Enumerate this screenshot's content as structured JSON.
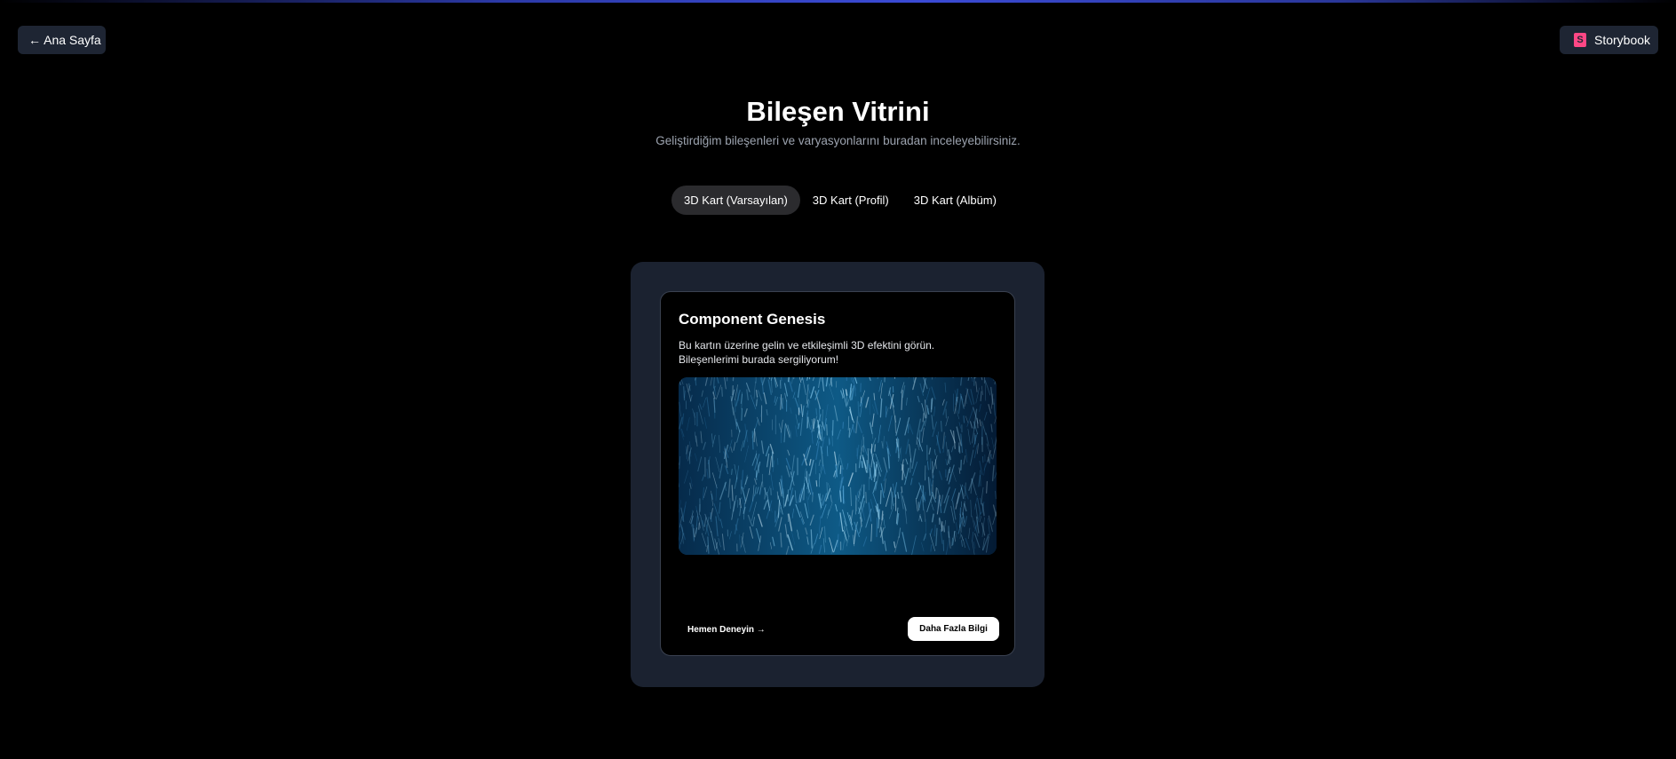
{
  "header": {
    "back_label": "← Ana Sayfa",
    "storybook_icon": "storybook-icon",
    "storybook_icon_glyph": "S",
    "storybook_label": "Storybook"
  },
  "main": {
    "title": "Bileşen Vitrini",
    "subtitle": "Geliştirdiğim bileşenleri ve varyasyonlarını buradan inceleyebilirsiniz.",
    "tabs": [
      {
        "label": "3D Kart (Varsayılan)",
        "active": true
      },
      {
        "label": "3D Kart (Profil)",
        "active": false
      },
      {
        "label": "3D Kart (Albüm)",
        "active": false
      }
    ]
  },
  "card": {
    "title": "Component Genesis",
    "description": "Bu kartın üzerine gelin ve etkileşimli 3D efektini görün. Bileşenlerimi burada sergiliyorum!",
    "image_icon": "abstract-blue-streaks-image",
    "try_label": "Hemen Deneyin →",
    "more_label": "Daha Fazla Bilgi"
  },
  "colors": {
    "background": "#000000",
    "button_bg": "#1e2533",
    "stage_bg": "#1b2230",
    "active_tab_bg": "#2b2b2e",
    "storybook_accent": "#ff4785",
    "subtitle_text": "#9ca3af"
  }
}
